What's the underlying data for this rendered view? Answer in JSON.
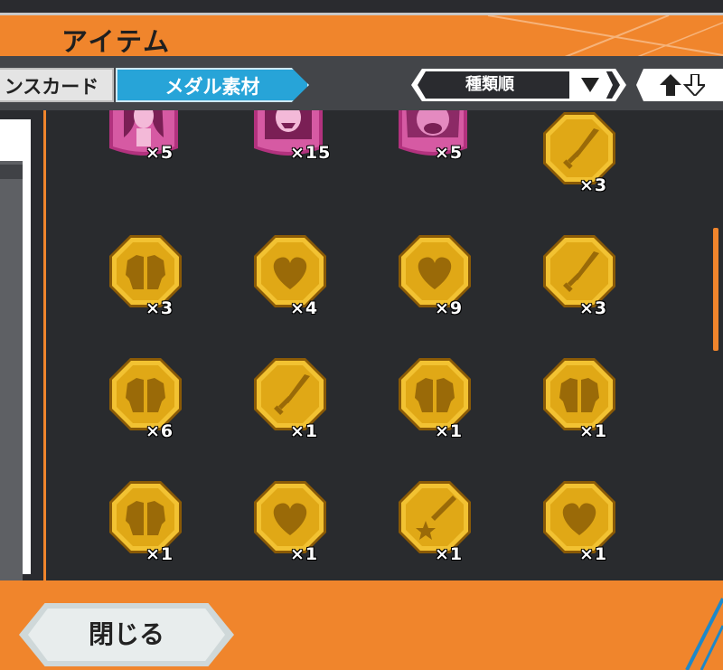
{
  "header": {
    "title": "アイテム"
  },
  "tabs": [
    {
      "label": "ンスカード",
      "active": false
    },
    {
      "label": "メダル素材",
      "active": true
    }
  ],
  "sort": {
    "label": "種類順"
  },
  "footer": {
    "close_label": "閉じる"
  },
  "colors": {
    "accent": "#f0852c",
    "panel": "#292b2e",
    "tab_active": "#27a4d8",
    "medal_gold": "#e9b21c"
  },
  "items": [
    {
      "type": "portrait-woman-icon",
      "count": "×5"
    },
    {
      "type": "portrait-man-icon",
      "count": "×15"
    },
    {
      "type": "portrait-beast-icon",
      "count": "×5"
    },
    {
      "type": "sword-medal-icon",
      "count": "×3"
    },
    {
      "type": "armor-medal-icon",
      "count": "×3"
    },
    {
      "type": "heart-medal-icon",
      "count": "×4"
    },
    {
      "type": "heart-medal-icon",
      "count": "×9"
    },
    {
      "type": "sword-medal-icon",
      "count": "×3"
    },
    {
      "type": "armor-medal-icon",
      "count": "×6"
    },
    {
      "type": "sword-medal-icon",
      "count": "×1"
    },
    {
      "type": "armor-medal-icon",
      "count": "×1"
    },
    {
      "type": "armor-medal-icon",
      "count": "×1"
    },
    {
      "type": "armor-medal-icon",
      "count": "×1"
    },
    {
      "type": "heart-medal-icon",
      "count": "×1"
    },
    {
      "type": "star-medal-icon",
      "count": "×1"
    },
    {
      "type": "heart-medal-icon",
      "count": "×1"
    }
  ]
}
